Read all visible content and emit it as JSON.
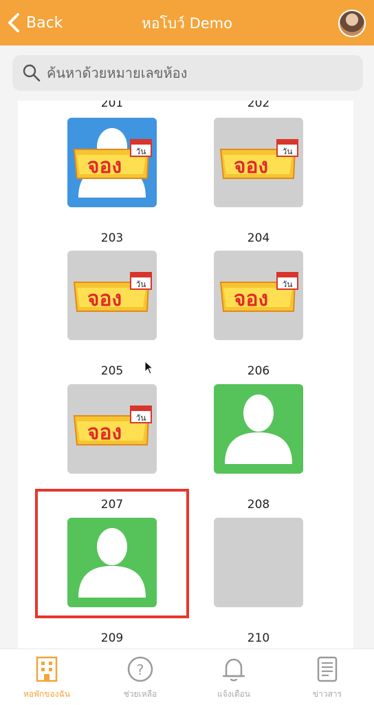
{
  "header": {
    "back_label": "Back",
    "title": "หอโบว์ Demo"
  },
  "search": {
    "placeholder": "ค้นหาด้วยหมายเลขห้อง"
  },
  "booking_badge": {
    "text": "จอง",
    "calendar_text": "วัน"
  },
  "rooms": [
    {
      "number": "201",
      "status": "booked-occupied",
      "color": "#3f95df"
    },
    {
      "number": "202",
      "status": "booked",
      "color": "#cfcfcf"
    },
    {
      "number": "203",
      "status": "booked",
      "color": "#cfcfcf"
    },
    {
      "number": "204",
      "status": "booked",
      "color": "#cfcfcf"
    },
    {
      "number": "205",
      "status": "booked",
      "color": "#cfcfcf"
    },
    {
      "number": "206",
      "status": "occupied",
      "color": "#55c25a"
    },
    {
      "number": "207",
      "status": "occupied",
      "color": "#55c25a",
      "highlighted": true
    },
    {
      "number": "208",
      "status": "vacant",
      "color": "#cfcfcf"
    },
    {
      "number": "209",
      "status": "unknown"
    },
    {
      "number": "210",
      "status": "unknown"
    }
  ],
  "bottom_nav": [
    {
      "label": "หอพักของฉัน",
      "icon": "building-icon",
      "active": true
    },
    {
      "label": "ช่วยเหลือ",
      "icon": "help-icon",
      "active": false
    },
    {
      "label": "แจ้งเตือน",
      "icon": "bell-icon",
      "active": false
    },
    {
      "label": "ข่าวสาร",
      "icon": "news-icon",
      "active": false
    }
  ],
  "colors": {
    "accent": "#f4a43a",
    "highlight": "#e5372b"
  }
}
